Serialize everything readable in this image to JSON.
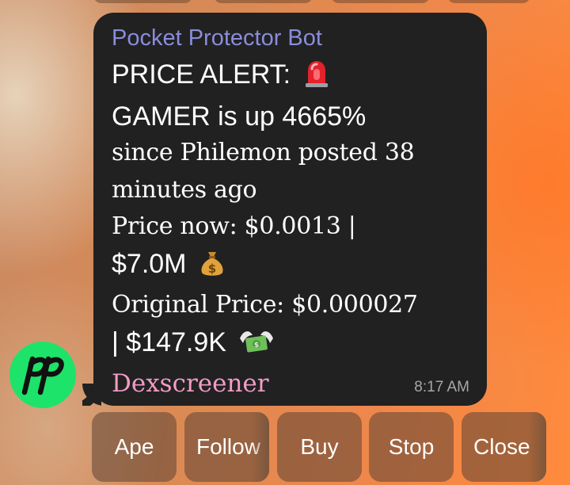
{
  "chat": {
    "sender": "Pocket Protector Bot",
    "avatar_icon": "pocket-protector-pp-logo",
    "avatar_color": "#1ee36a",
    "message_lines": [
      "PRICE ALERT:",
      "GAMER is up 4665%",
      "since Philemon posted 38",
      "minutes ago",
      "Price now: $0.0013 |",
      "$7.0M",
      "Original Price: $0.000027",
      "| $147.9K"
    ],
    "icons": {
      "alert": "police-light-emoji",
      "money_bag": "money-bag-emoji",
      "money_wings": "money-with-wings-emoji"
    },
    "link_text": "Dexscreener",
    "time": "8:17 AM"
  },
  "buttons": [
    {
      "label": "Ape"
    },
    {
      "label": "Follow"
    },
    {
      "label": "Buy"
    },
    {
      "label": "Stop"
    },
    {
      "label": "Close"
    }
  ],
  "colors": {
    "bubble": "#212121",
    "sender": "#8a8cdb",
    "link": "#f29bc6",
    "text": "#ffffff",
    "time": "#a7a7a7"
  }
}
